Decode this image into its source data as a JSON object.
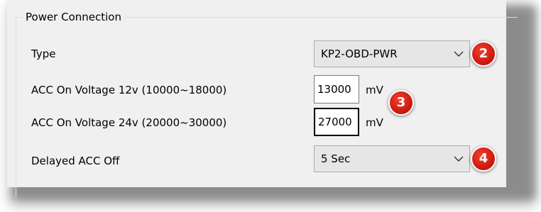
{
  "group": {
    "title": "Power Connection"
  },
  "type_row": {
    "label": "Type",
    "value": "KP2-OBD-PWR"
  },
  "acc12_row": {
    "label": "ACC On Voltage 12v (10000~18000)",
    "value": "13000",
    "unit": "mV"
  },
  "acc24_row": {
    "label": "ACC On Voltage 24v (20000~30000)",
    "value": "27000",
    "unit": "mV"
  },
  "delay_row": {
    "label": "Delayed ACC Off",
    "value": "5 Sec"
  },
  "callouts": {
    "type": "2",
    "voltage": "3",
    "delay": "4"
  },
  "colors": {
    "panel": "#f0f0f0",
    "combo": "#e6e6e6",
    "callout": "#d8241a"
  },
  "icons": {
    "dropdown": "chevron-down-icon"
  }
}
